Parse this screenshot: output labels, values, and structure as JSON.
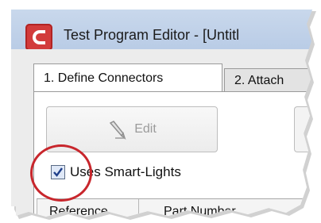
{
  "window": {
    "title": "Test Program Editor - [Untitl"
  },
  "tabs": [
    {
      "label": "1.  Define Connectors",
      "active": true
    },
    {
      "label": "2.  Attach",
      "active": false
    }
  ],
  "toolbar": {
    "edit_label": "Edit",
    "edit_enabled": false
  },
  "options": {
    "smart_lights_label": "Uses Smart-Lights",
    "smart_lights_checked": true
  },
  "grid": {
    "columns": [
      "Reference",
      "Part Number"
    ]
  },
  "icons": {
    "app": "app-logo-icon",
    "edit": "pencil-icon",
    "checkbox": "checkmark-icon"
  },
  "colors": {
    "highlight_circle": "#c8262c",
    "app_logo": "#d23b3b",
    "titlebar": "#c9d8ec"
  }
}
